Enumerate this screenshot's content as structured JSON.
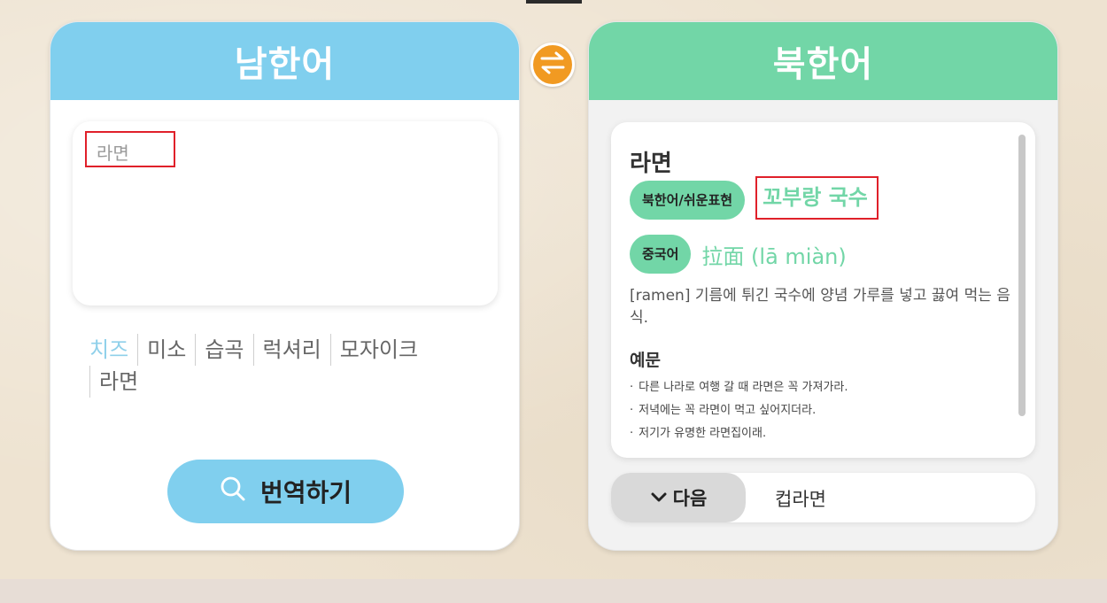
{
  "source_panel": {
    "title": "남한어",
    "input_value": "라면",
    "suggestions": [
      "치즈",
      "미소",
      "습곡",
      "럭셔리",
      "모자이크",
      "라면"
    ],
    "translate_label": "번역하기"
  },
  "target_panel": {
    "title": "북한어",
    "result": {
      "word": "라면",
      "north_tag": "북한어/쉬운표현",
      "north_value": "꼬부랑 국수",
      "chinese_tag": "중국어",
      "chinese_value": "拉面 (lā miàn)",
      "definition": "[ramen] 기름에 튀긴 국수에 양념 가루를 넣고 끓여 먹는 음식.",
      "examples_title": "예문",
      "examples": [
        "다른 나라로 여행 갈 때 라면은 꼭 가져가라.",
        "저녁에는 꼭 라면이 먹고 싶어지더라.",
        "저기가 유명한 라면집이래."
      ]
    },
    "next_label": "다음",
    "next_suggestion": "컵라면"
  },
  "colors": {
    "source_accent": "#80cfee",
    "target_accent": "#72d6a7",
    "swap_button": "#f19a22",
    "highlight_box": "#e0202a"
  },
  "icons": {
    "swap": "swap-arrows-icon",
    "search": "search-icon",
    "next": "chevron-down-icon"
  }
}
